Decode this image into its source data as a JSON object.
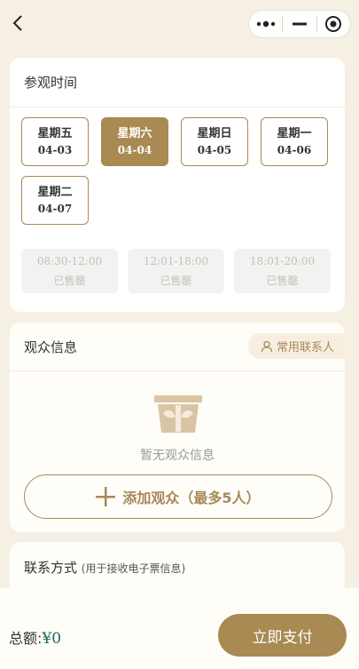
{
  "nav": {
    "back_icon": "chevron-left-icon",
    "capsule_icons": [
      "more-dots-icon",
      "minimize-icon",
      "target-icon"
    ]
  },
  "visit": {
    "title": "参观时间",
    "dates": [
      {
        "weekday": "星期五",
        "date": "04-03",
        "selected": false
      },
      {
        "weekday": "星期六",
        "date": "04-04",
        "selected": true
      },
      {
        "weekday": "星期日",
        "date": "04-05",
        "selected": false
      },
      {
        "weekday": "星期一",
        "date": "04-06",
        "selected": false
      },
      {
        "weekday": "星期二",
        "date": "04-07",
        "selected": false
      }
    ],
    "slots": [
      {
        "time": "08:30-12:00",
        "status": "已售罄"
      },
      {
        "time": "12:01-18:00",
        "status": "已售罄"
      },
      {
        "time": "18:01-20:00",
        "status": "已售罄"
      }
    ]
  },
  "audience": {
    "title": "观众信息",
    "contacts_label": "常用联系人",
    "empty_text": "暂无观众信息",
    "add_label": "添加观众（最多5人）",
    "empty_icon": "bronze-mask-icon"
  },
  "contact": {
    "title": "联系方式",
    "subtitle": "(用于接收电子票信息)"
  },
  "footer": {
    "total_label": "总额:",
    "total_amount": "¥0",
    "pay_label": "立即支付"
  },
  "colors": {
    "accent": "#a88a52",
    "background": "#f6efe3",
    "amount": "#1f6a5c"
  }
}
